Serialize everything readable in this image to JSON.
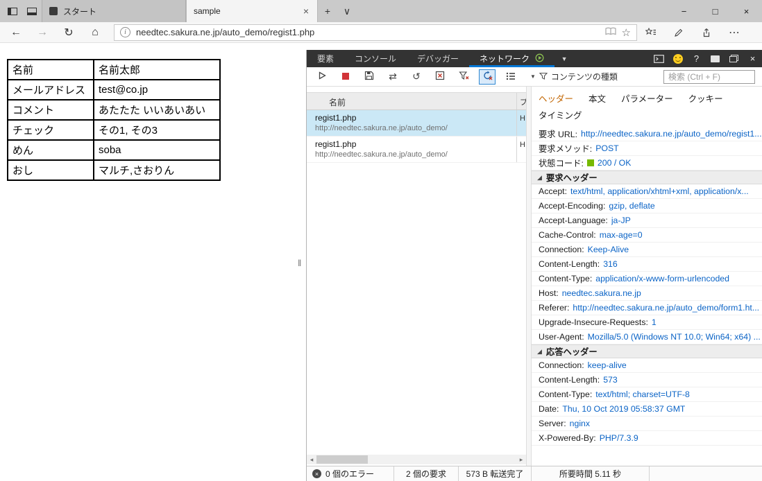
{
  "colors": {
    "accent_blue": "#0078d7",
    "link_blue": "#0a63c6",
    "status_green": "#76b900",
    "selected_row": "#cbe8f6",
    "devtools_tabbar": "#333333",
    "active_detail_tab": "#c26500"
  },
  "icons": {
    "back": "←",
    "forward": "→",
    "refresh": "↻",
    "home": "⌂",
    "info": "i",
    "star": "☆",
    "more": "⋯",
    "plus": "+",
    "chevron_small": "∨",
    "minimize": "−",
    "maximize": "□",
    "close": "×",
    "chevron_down": "▼",
    "arrows_swap": "⇄",
    "arrow_undo": "↺",
    "help": "?",
    "section_triangle": "◢",
    "scroll_left": "◂",
    "scroll_right": "▸",
    "splitter_grip": "‖"
  },
  "browser": {
    "titlebar": {
      "tabs": [
        {
          "label": "スタート",
          "active": false
        },
        {
          "label": "sample",
          "active": true
        }
      ]
    },
    "addressbar": {
      "url": "needtec.sakura.ne.jp/auto_demo/regist1.php"
    }
  },
  "page": {
    "form_table": {
      "rows": [
        {
          "label": "名前",
          "value": "名前太郎"
        },
        {
          "label": "メールアドレス",
          "value": "test@co.jp"
        },
        {
          "label": "コメント",
          "value": "あたたた いいあいあい"
        },
        {
          "label": "チェック",
          "value": "その1, その3"
        },
        {
          "label": "めん",
          "value": "soba"
        },
        {
          "label": "おし",
          "value": "マルチ,さおりん"
        }
      ]
    }
  },
  "devtools": {
    "tabs": [
      {
        "label": "要素"
      },
      {
        "label": "コンソール"
      },
      {
        "label": "デバッガー"
      },
      {
        "label": "ネットワーク"
      }
    ],
    "toolbar": {
      "content_type_label": "コンテンツの種類",
      "search_placeholder": "検索 (Ctrl + F)"
    },
    "request_list": {
      "name_column": "名前",
      "protocol_column": "プ",
      "requests": [
        {
          "name": "regist1.php",
          "url": "http://needtec.sakura.ne.jp/auto_demo/",
          "protocol": "H"
        },
        {
          "name": "regist1.php",
          "url": "http://needtec.sakura.ne.jp/auto_demo/",
          "protocol": "H"
        }
      ]
    },
    "details": {
      "tabs": [
        "ヘッダー",
        "本文",
        "パラメーター",
        "クッキー",
        "タイミング"
      ],
      "summary": [
        {
          "label": "要求 URL:",
          "value": "http://needtec.sakura.ne.jp/auto_demo/regist1..."
        },
        {
          "label": "要求メソッド:",
          "value": "POST"
        },
        {
          "label": "状態コード:",
          "value": "200 / OK"
        }
      ],
      "request_headers": {
        "title": "要求ヘッダー",
        "items": [
          {
            "label": "Accept:",
            "value": "text/html, application/xhtml+xml, application/x..."
          },
          {
            "label": "Accept-Encoding:",
            "value": "gzip, deflate"
          },
          {
            "label": "Accept-Language:",
            "value": "ja-JP"
          },
          {
            "label": "Cache-Control:",
            "value": "max-age=0"
          },
          {
            "label": "Connection:",
            "value": "Keep-Alive"
          },
          {
            "label": "Content-Length:",
            "value": "316"
          },
          {
            "label": "Content-Type:",
            "value": "application/x-www-form-urlencoded"
          },
          {
            "label": "Host:",
            "value": "needtec.sakura.ne.jp"
          },
          {
            "label": "Referer:",
            "value": "http://needtec.sakura.ne.jp/auto_demo/form1.ht..."
          },
          {
            "label": "Upgrade-Insecure-Requests:",
            "value": "1"
          },
          {
            "label": "User-Agent:",
            "value": "Mozilla/5.0 (Windows NT 10.0; Win64; x64) ..."
          }
        ]
      },
      "response_headers": {
        "title": "応答ヘッダー",
        "items": [
          {
            "label": "Connection:",
            "value": "keep-alive"
          },
          {
            "label": "Content-Length:",
            "value": "573"
          },
          {
            "label": "Content-Type:",
            "value": "text/html; charset=UTF-8"
          },
          {
            "label": "Date:",
            "value": "Thu, 10 Oct 2019 05:58:37 GMT"
          },
          {
            "label": "Server:",
            "value": "nginx"
          },
          {
            "label": "X-Powered-By:",
            "value": "PHP/7.3.9"
          }
        ]
      }
    },
    "status_bar": {
      "errors": "0 個のエラー",
      "requests": "2 個の要求",
      "transferred": "573 B 転送完了",
      "elapsed": "所要時間 5.11 秒"
    }
  }
}
